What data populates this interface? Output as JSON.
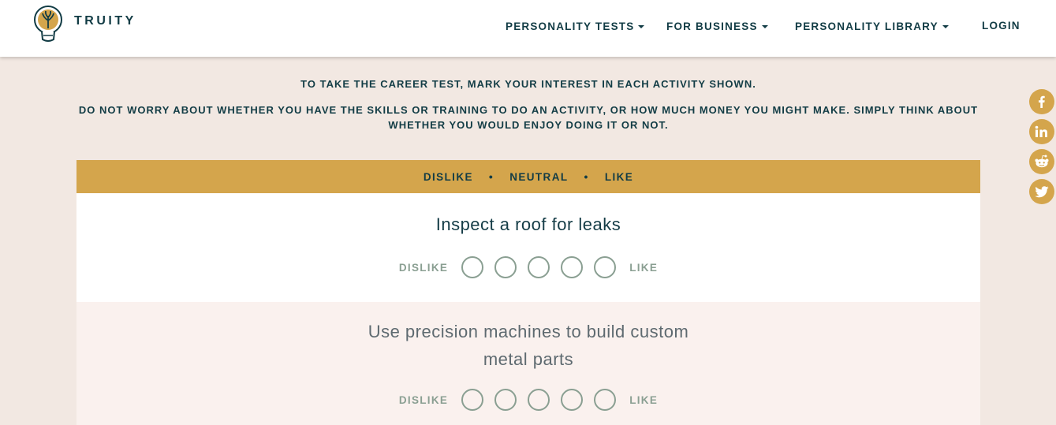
{
  "brand": {
    "name": "TRUITY"
  },
  "nav": {
    "personality_tests": "PERSONALITY TESTS",
    "for_business": "FOR BUSINESS",
    "personality_library": "PERSONALITY LIBRARY",
    "login": "LOGIN"
  },
  "intro": {
    "line1": "TO TAKE THE CAREER TEST, MARK YOUR INTEREST IN EACH ACTIVITY SHOWN.",
    "line2": "DO NOT WORRY ABOUT WHETHER YOU HAVE THE SKILLS OR TRAINING TO DO AN ACTIVITY, OR HOW MUCH MONEY YOU MIGHT MAKE. SIMPLY THINK ABOUT WHETHER YOU WOULD ENJOY DOING IT OR NOT."
  },
  "scale_header": {
    "dislike": "DISLIKE",
    "neutral": "NEUTRAL",
    "like": "LIKE",
    "separator": "•"
  },
  "questions": [
    {
      "text": "Inspect a roof for leaks",
      "left_label": "DISLIKE",
      "right_label": "LIKE"
    },
    {
      "text": "Use precision machines to build custom metal parts",
      "left_label": "DISLIKE",
      "right_label": "LIKE"
    }
  ],
  "social": [
    "facebook-icon",
    "linkedin-icon",
    "reddit-icon",
    "twitter-icon"
  ],
  "colors": {
    "accent": "#d4a54c",
    "navy": "#123c45",
    "page_bg": "#f2e8e2",
    "muted_green": "#8a9f92"
  }
}
